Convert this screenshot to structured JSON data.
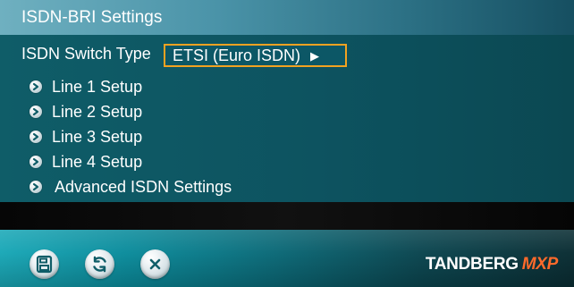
{
  "window": {
    "title": "ISDN-BRI Settings"
  },
  "switch": {
    "label": "ISDN Switch Type",
    "value": "ETSI (Euro ISDN)",
    "arrow": "▶"
  },
  "menu": {
    "items": [
      {
        "label": "Line 1 Setup"
      },
      {
        "label": "Line 2 Setup"
      },
      {
        "label": "Line 3 Setup"
      },
      {
        "label": "Line 4 Setup"
      },
      {
        "label": "Advanced ISDN Settings"
      }
    ]
  },
  "footer": {
    "brand_main": "TANDBERG",
    "brand_suffix": "MXP",
    "icons": {
      "save": "save-icon",
      "refresh": "refresh-icon",
      "cancel": "close-icon"
    }
  },
  "colors": {
    "highlight": "#f2a221",
    "brand_accent": "#ff6a2b"
  }
}
